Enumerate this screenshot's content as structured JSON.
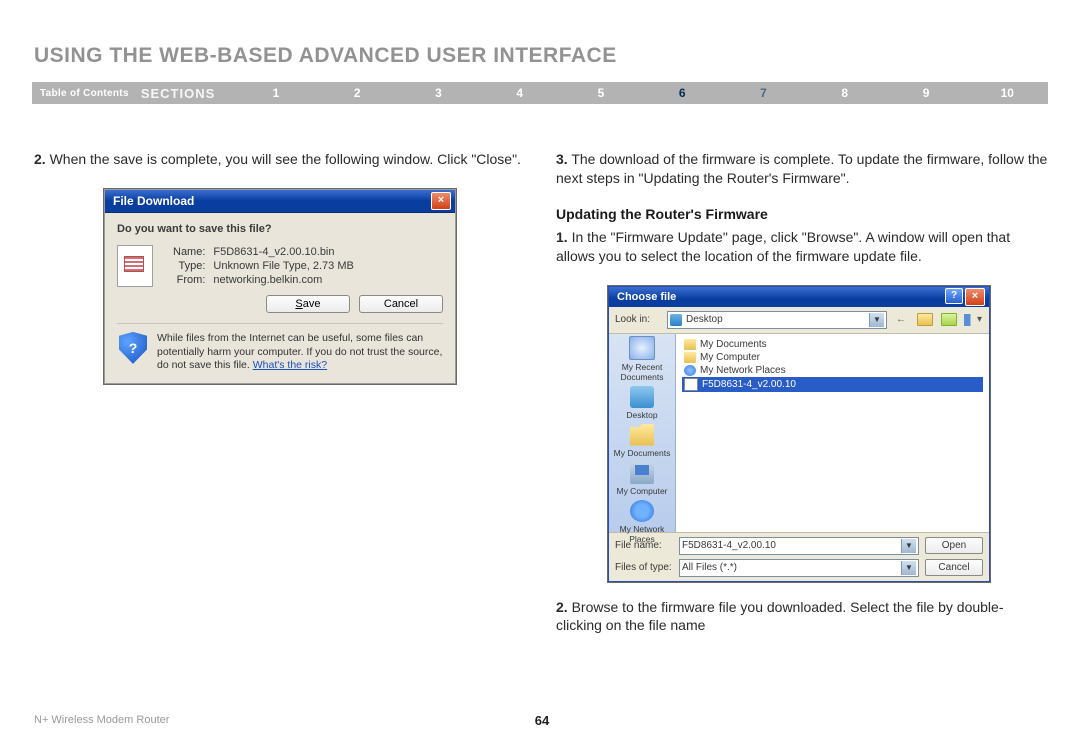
{
  "title": "USING THE WEB-BASED ADVANCED USER INTERFACE",
  "nav": {
    "toc": "Table of Contents",
    "sections_label": "SECTIONS",
    "nums": [
      "1",
      "2",
      "3",
      "4",
      "5",
      "6",
      "7",
      "8",
      "9",
      "10"
    ],
    "active": "6"
  },
  "left": {
    "step2": "When the save is complete, you will see the following window. Click \"Close\"."
  },
  "right": {
    "step3": "The download of the firmware is complete. To update the firmware, follow the next steps in \"Updating the Router's Firmware\".",
    "subheading": "Updating the Router's Firmware",
    "r1": "In the \"Firmware Update\" page, click \"Browse\". A window will open that allows you to select the location of the firmware update file.",
    "r2": "Browse to the firmware file you downloaded. Select the file by double-clicking on the file name"
  },
  "filedl": {
    "title": "File Download",
    "question": "Do you want to save this file?",
    "name_k": "Name:",
    "name_v": "F5D8631-4_v2.00.10.bin",
    "type_k": "Type:",
    "type_v": "Unknown File Type, 2.73 MB",
    "from_k": "From:",
    "from_v": "networking.belkin.com",
    "save": "Save",
    "cancel": "Cancel",
    "warn": "While files from the Internet can be useful, some files can potentially harm your computer. If you do not trust the source, do not save this file.",
    "whats_risk": "What's the risk?"
  },
  "choose": {
    "title": "Choose file",
    "lookin_label": "Look in:",
    "lookin_value": "Desktop",
    "sidebar": [
      {
        "label": "My Recent Documents",
        "cls": "recent"
      },
      {
        "label": "Desktop",
        "cls": "desktop"
      },
      {
        "label": "My Documents",
        "cls": "docs"
      },
      {
        "label": "My Computer",
        "cls": "comp"
      },
      {
        "label": "My Network Places",
        "cls": "net"
      }
    ],
    "files": [
      {
        "label": "My Documents",
        "cls": "folder"
      },
      {
        "label": "My Computer",
        "cls": "folder"
      },
      {
        "label": "My Network Places",
        "cls": "net"
      },
      {
        "label": "F5D8631-4_v2.00.10",
        "cls": "file",
        "selected": true
      }
    ],
    "filename_label": "File name:",
    "filename_value": "F5D8631-4_v2.00.10",
    "filesoftype_label": "Files of type:",
    "filesoftype_value": "All Files (*.*)",
    "open": "Open",
    "cancel": "Cancel"
  },
  "footer": {
    "product": "N+ Wireless Modem Router",
    "page": "64"
  }
}
